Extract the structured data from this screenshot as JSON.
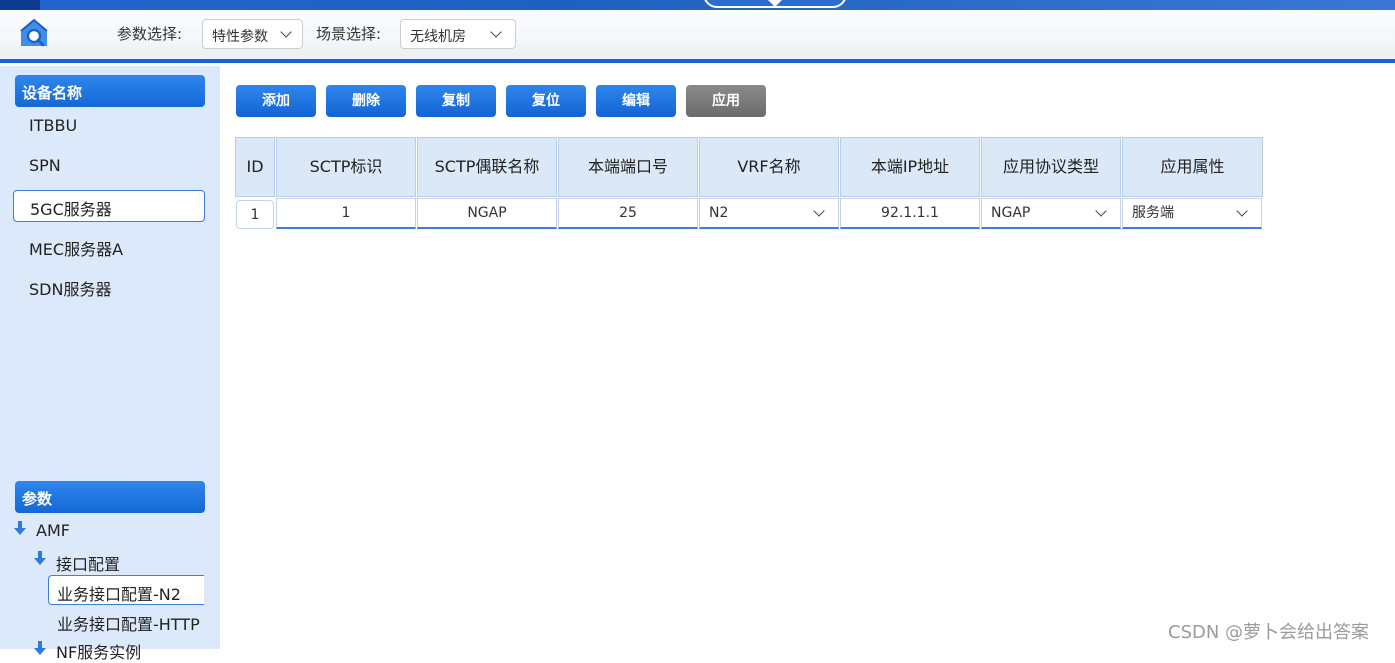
{
  "header": {
    "param_select_label": "参数选择:",
    "param_select_value": "特性参数",
    "scene_select_label": "场景选择:",
    "scene_select_value": "无线机房"
  },
  "sidebar": {
    "device_header": "设备名称",
    "devices": [
      "ITBBU",
      "SPN",
      "5GC服务器",
      "MEC服务器A",
      "SDN服务器"
    ],
    "selected_device": "5GC服务器",
    "params_header": "参数",
    "tree": {
      "root": "AMF",
      "group": "接口配置",
      "selected_leaf": "业务接口配置-N2",
      "leaf2": "业务接口配置-HTTP",
      "next_group": "NF服务实例"
    }
  },
  "toolbar": {
    "add": "添加",
    "delete": "删除",
    "copy": "复制",
    "reset": "复位",
    "edit": "编辑",
    "apply": "应用"
  },
  "table": {
    "columns": [
      "ID",
      "SCTP标识",
      "SCTP偶联名称",
      "本端端口号",
      "VRF名称",
      "本端IP地址",
      "应用协议类型",
      "应用属性"
    ],
    "row": {
      "id": "1",
      "sctp_id": "1",
      "sctp_name": "NGAP",
      "local_port": "25",
      "vrf": "N2",
      "local_ip": "92.1.1.1",
      "protocol": "NGAP",
      "attribute": "服务端"
    }
  },
  "watermark": "CSDN @萝卜会给出答案",
  "colors": {
    "accent": "#1468d6",
    "sidebar_bg": "#dce9fa",
    "header_cell_bg": "#dbe8f8",
    "apply_button": "#6b6b6b"
  }
}
